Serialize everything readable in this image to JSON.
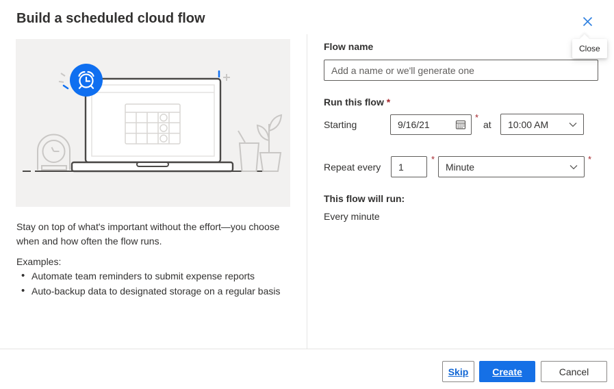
{
  "dialog": {
    "title": "Build a scheduled cloud flow",
    "close_tooltip": "Close"
  },
  "colors": {
    "primary_button": "#1570e6",
    "illustration_accent": "#0f6ff0",
    "link": "#1166d4",
    "close_icon": "#2f80e0",
    "required": "#a4262c"
  },
  "left": {
    "description": "Stay on top of what's important without the effort—you choose when and how often the flow runs.",
    "examples_label": "Examples:",
    "examples": [
      "Automate team reminders to submit expense reports",
      "Auto-backup data to designated storage on a regular basis"
    ]
  },
  "form": {
    "flow_name_label": "Flow name",
    "flow_name_placeholder": "Add a name or we'll generate one",
    "run_this_flow_label": "Run this flow",
    "required_mark": "*",
    "starting_label": "Starting",
    "starting_date": "9/16/21",
    "at_label": "at",
    "starting_time": "10:00 AM",
    "repeat_every_label": "Repeat every",
    "repeat_interval": "1",
    "repeat_frequency": "Minute",
    "summary_label": "This flow will run:",
    "summary_value": "Every minute"
  },
  "footer": {
    "skip_label": "Skip",
    "create_label": "Create",
    "cancel_label": "Cancel"
  }
}
